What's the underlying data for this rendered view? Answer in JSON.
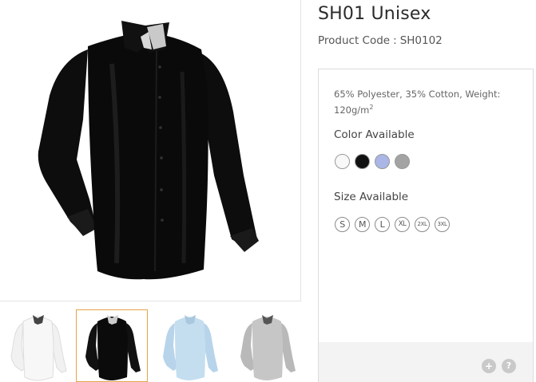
{
  "product": {
    "title": "SH01 Unisex",
    "code_label": "Product Code",
    "code_separator": ":",
    "code_value": "SH0102",
    "composition_text": "65% Polyester, 35% Cotton, Weight: 120g/m",
    "composition_superscript": "2",
    "main_image_alt": "Black shirt"
  },
  "colors": {
    "heading": "Color Available",
    "swatches": [
      {
        "name": "white",
        "hex": "#f8f8f8"
      },
      {
        "name": "black",
        "hex": "#111111"
      },
      {
        "name": "light-blue",
        "hex": "#a9b6e6"
      },
      {
        "name": "grey",
        "hex": "#a3a3a3"
      }
    ]
  },
  "sizes": {
    "heading": "Size Available",
    "items": [
      "S",
      "M",
      "L",
      "XL",
      "2XL",
      "3XL"
    ]
  },
  "thumbnails": [
    {
      "name": "white",
      "color": "#f4f4f4",
      "active": false
    },
    {
      "name": "black",
      "color": "#111111",
      "active": true
    },
    {
      "name": "light-blue",
      "color": "#bcd9ee",
      "active": false
    },
    {
      "name": "grey",
      "color": "#bdbdbd",
      "active": false
    }
  ],
  "footer": {
    "plus_label": "+",
    "help_label": "?"
  },
  "theme": {
    "active_thumb_border": "#e3a54a",
    "footer_bg": "#f3f3f3"
  }
}
